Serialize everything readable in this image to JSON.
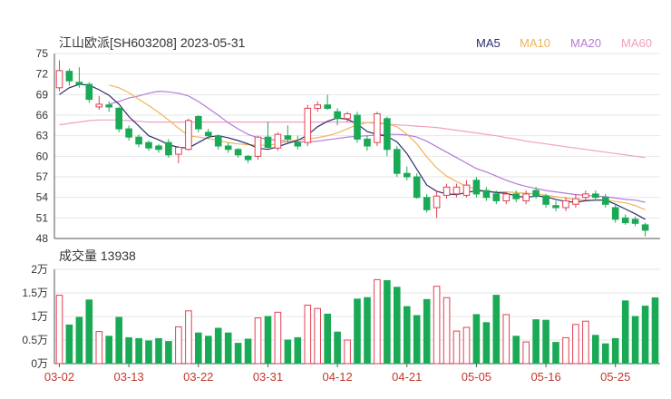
{
  "chart_data": [
    {
      "type": "candlestick",
      "title": "江山欧派[SH603208] 2023-05-31",
      "legend": [
        {
          "label": "MA5",
          "color": "#2d2d6e"
        },
        {
          "label": "MA10",
          "color": "#f0b45a"
        },
        {
          "label": "MA20",
          "color": "#b57ad6"
        },
        {
          "label": "MA60",
          "color": "#f0a0c0"
        }
      ],
      "y_ticks": [
        "75",
        "72",
        "69",
        "66",
        "63",
        "60",
        "57",
        "54",
        "51",
        "48"
      ],
      "ylim": [
        48,
        75
      ],
      "grid": true,
      "colors": {
        "up": "#e04050",
        "down": "#1aaa55"
      },
      "candles": [
        [
          70.0,
          72.5,
          74.0,
          69.5
        ],
        [
          72.4,
          71.0,
          72.8,
          70.3
        ],
        [
          70.8,
          70.5,
          73.0,
          70.0
        ],
        [
          70.5,
          68.3,
          70.8,
          67.8
        ],
        [
          67.2,
          67.6,
          68.8,
          66.8
        ],
        [
          67.5,
          67.2,
          68.0,
          66.5
        ],
        [
          67.0,
          64.0,
          67.2,
          63.5
        ],
        [
          64.0,
          62.8,
          64.5,
          62.3
        ],
        [
          62.8,
          61.8,
          63.2,
          61.3
        ],
        [
          62.0,
          61.2,
          62.3,
          60.8
        ],
        [
          61.5,
          61.0,
          61.8,
          60.5
        ],
        [
          62.0,
          60.2,
          62.5,
          59.8
        ],
        [
          60.3,
          61.3,
          61.5,
          59.0
        ],
        [
          61.0,
          65.2,
          65.5,
          60.8
        ],
        [
          65.8,
          64.0,
          66.0,
          63.5
        ],
        [
          63.5,
          63.0,
          64.0,
          62.5
        ],
        [
          63.0,
          61.5,
          63.2,
          61.0
        ],
        [
          61.5,
          61.0,
          62.0,
          60.5
        ],
        [
          61.0,
          60.2,
          61.2,
          59.8
        ],
        [
          60.0,
          59.5,
          60.2,
          59.0
        ],
        [
          60.0,
          62.8,
          63.0,
          59.5
        ],
        [
          62.8,
          61.3,
          65.0,
          61.0
        ],
        [
          61.2,
          63.2,
          63.5,
          60.8
        ],
        [
          63.0,
          62.5,
          64.5,
          62.0
        ],
        [
          62.0,
          61.5,
          63.0,
          61.0
        ],
        [
          62.0,
          67.0,
          67.5,
          61.5
        ],
        [
          67.0,
          67.5,
          68.0,
          66.5
        ],
        [
          67.5,
          67.0,
          69.0,
          66.8
        ],
        [
          66.5,
          65.5,
          67.0,
          64.5
        ],
        [
          65.5,
          66.2,
          66.5,
          65.0
        ],
        [
          66.0,
          62.5,
          66.5,
          62.0
        ],
        [
          62.5,
          61.5,
          63.0,
          60.8
        ],
        [
          62.0,
          66.2,
          66.5,
          61.5
        ],
        [
          65.5,
          61.0,
          65.8,
          60.0
        ],
        [
          61.0,
          57.5,
          61.5,
          57.0
        ],
        [
          57.5,
          57.0,
          58.5,
          56.5
        ],
        [
          57.0,
          54.0,
          57.5,
          53.8
        ],
        [
          54.0,
          52.2,
          54.5,
          51.8
        ],
        [
          52.5,
          54.2,
          55.0,
          51.0
        ],
        [
          54.3,
          55.5,
          56.0,
          53.8
        ],
        [
          54.5,
          55.5,
          56.0,
          54.0
        ],
        [
          54.3,
          55.8,
          56.5,
          54.0
        ],
        [
          56.5,
          54.5,
          57.0,
          54.0
        ],
        [
          55.0,
          54.0,
          55.5,
          53.5
        ],
        [
          54.5,
          53.5,
          55.0,
          53.0
        ],
        [
          53.5,
          54.5,
          54.8,
          53.0
        ],
        [
          54.5,
          53.8,
          55.0,
          53.3
        ],
        [
          53.5,
          54.5,
          55.0,
          53.0
        ],
        [
          55.0,
          54.2,
          55.5,
          53.8
        ],
        [
          54.2,
          53.0,
          54.5,
          52.5
        ],
        [
          52.8,
          52.5,
          53.5,
          52.0
        ],
        [
          52.5,
          53.5,
          54.0,
          52.0
        ],
        [
          53.0,
          53.8,
          54.5,
          52.5
        ],
        [
          54.0,
          54.5,
          55.0,
          53.5
        ],
        [
          54.5,
          54.0,
          55.0,
          53.5
        ],
        [
          54.0,
          53.0,
          54.5,
          52.5
        ],
        [
          52.5,
          50.8,
          53.0,
          50.3
        ],
        [
          51.0,
          50.3,
          51.5,
          50.0
        ],
        [
          50.8,
          50.2,
          51.2,
          49.8
        ],
        [
          50.0,
          49.2,
          50.3,
          48.3
        ]
      ],
      "ma5": [
        69.0,
        70.0,
        70.5,
        70.4,
        69.7,
        68.9,
        67.6,
        65.8,
        64.4,
        63.0,
        62.4,
        61.7,
        61.3,
        61.2,
        62.0,
        62.8,
        63.0,
        62.7,
        62.3,
        61.8,
        61.2,
        61.0,
        61.4,
        61.9,
        62.3,
        63.1,
        64.3,
        65.1,
        65.6,
        65.4,
        64.7,
        63.6,
        63.2,
        62.9,
        62.1,
        60.4,
        58.1,
        55.8,
        54.9,
        54.5,
        54.4,
        54.7,
        55.0,
        54.9,
        54.7,
        54.6,
        54.2,
        54.0,
        54.2,
        54.1,
        53.7,
        53.4,
        53.3,
        53.5,
        53.6,
        53.6,
        53.0,
        52.3,
        51.6,
        50.8
      ],
      "ma10": [
        null,
        null,
        null,
        null,
        null,
        70.4,
        70.0,
        69.3,
        68.3,
        67.4,
        66.4,
        65.3,
        64.1,
        63.0,
        62.8,
        62.6,
        62.3,
        62.0,
        61.8,
        61.7,
        61.6,
        61.6,
        61.8,
        62.2,
        62.4,
        62.5,
        62.7,
        63.0,
        63.4,
        64.0,
        64.6,
        64.9,
        65.0,
        64.7,
        64.3,
        63.2,
        61.8,
        59.9,
        58.3,
        57.1,
        56.3,
        55.6,
        55.2,
        54.9,
        54.8,
        54.8,
        54.7,
        54.6,
        54.5,
        54.3,
        54.1,
        53.9,
        53.7,
        53.6,
        53.6,
        53.6,
        53.4,
        53.2,
        52.8,
        52.2
      ],
      "ma20": [
        null,
        null,
        null,
        null,
        null,
        67.6,
        68.0,
        68.5,
        68.8,
        69.2,
        69.5,
        69.4,
        69.2,
        68.8,
        68.0,
        67.0,
        66.0,
        64.9,
        64.0,
        63.2,
        62.7,
        62.5,
        62.3,
        62.2,
        62.1,
        62.1,
        62.2,
        62.4,
        62.6,
        62.8,
        62.9,
        63.0,
        63.1,
        63.2,
        63.2,
        63.1,
        62.8,
        62.2,
        61.4,
        60.6,
        59.8,
        59.0,
        58.2,
        57.7,
        57.1,
        56.5,
        56.0,
        55.6,
        55.3,
        55.0,
        54.8,
        54.6,
        54.4,
        54.3,
        54.2,
        54.1,
        53.9,
        53.7,
        53.6,
        53.3
      ],
      "ma60": [
        64.6,
        64.8,
        65.0,
        65.2,
        65.3,
        65.3,
        65.3,
        65.2,
        65.1,
        65.0,
        65.0,
        65.0,
        65.0,
        65.0,
        65.0,
        65.0,
        65.0,
        65.0,
        65.0,
        65.0,
        65.0,
        65.0,
        65.0,
        65.0,
        65.0,
        65.0,
        65.0,
        65.0,
        65.0,
        65.0,
        65.0,
        64.9,
        64.8,
        64.7,
        64.6,
        64.5,
        64.4,
        64.3,
        64.2,
        64.0,
        63.8,
        63.6,
        63.4,
        63.2,
        63.0,
        62.7,
        62.5,
        62.2,
        62.0,
        61.8,
        61.6,
        61.4,
        61.2,
        61.0,
        60.8,
        60.6,
        60.4,
        60.2,
        60.0,
        59.8
      ],
      "x_ticks": [
        {
          "label": "03-02",
          "index": 0
        },
        {
          "label": "03-13",
          "index": 7
        },
        {
          "label": "03-22",
          "index": 14
        },
        {
          "label": "03-31",
          "index": 21
        },
        {
          "label": "04-12",
          "index": 28
        },
        {
          "label": "04-21",
          "index": 35
        },
        {
          "label": "05-05",
          "index": 42
        },
        {
          "label": "05-16",
          "index": 49
        },
        {
          "label": "05-25",
          "index": 56
        }
      ]
    },
    {
      "type": "bar",
      "title": "成交量 13938",
      "y_ticks": [
        "2万",
        "1.5万",
        "1万",
        "0.5万",
        "0万"
      ],
      "ylim": [
        0,
        20000
      ],
      "grid": true,
      "values": [
        14500,
        8200,
        9800,
        13500,
        6800,
        5800,
        9800,
        5500,
        5300,
        4800,
        5300,
        4700,
        7800,
        11200,
        6500,
        5800,
        7500,
        6500,
        4300,
        5200,
        9700,
        10000,
        10900,
        5000,
        5500,
        12400,
        11700,
        10500,
        6700,
        5000,
        13700,
        14000,
        17800,
        17600,
        16200,
        12100,
        10200,
        13600,
        16400,
        14000,
        6900,
        7700,
        10400,
        8700,
        14500,
        10400,
        5800,
        4600,
        9300,
        9200,
        4500,
        5500,
        8300,
        9000,
        6000,
        4200,
        5300,
        13300,
        10000,
        12200,
        13938
      ]
    }
  ]
}
